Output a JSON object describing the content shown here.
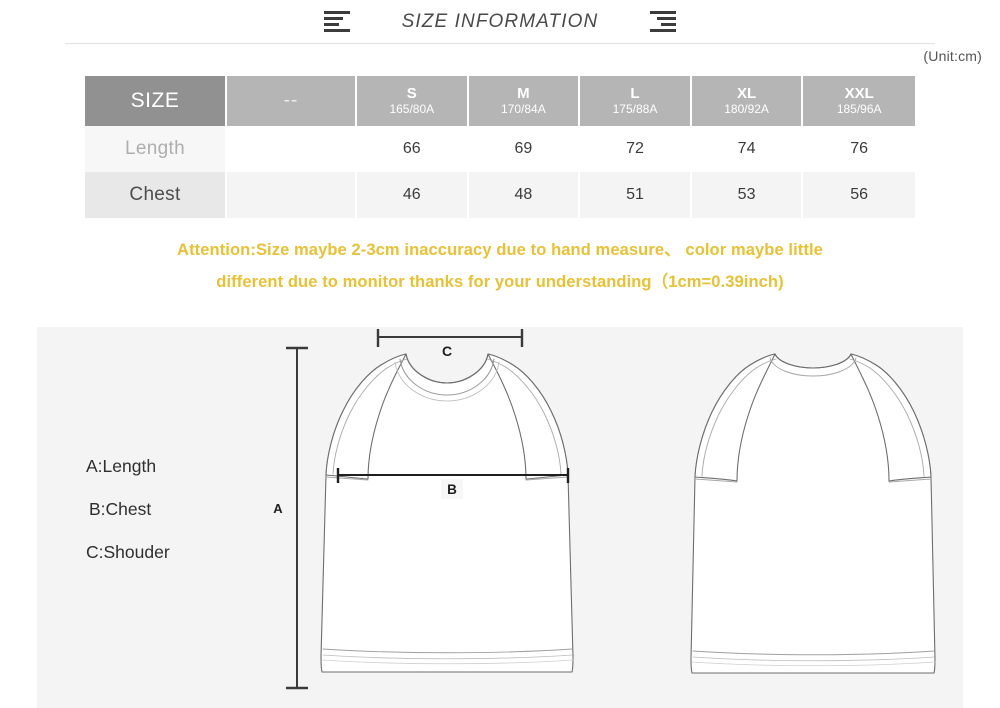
{
  "header": {
    "title": "SIZE INFORMATION",
    "left_icon": "align-left-icon",
    "right_icon": "align-right-icon"
  },
  "unit_note": "(Unit:cm)",
  "table": {
    "corner_label": "SIZE",
    "dash_label": "--",
    "columns": [
      {
        "name": "S",
        "spec": "165/80A"
      },
      {
        "name": "M",
        "spec": "170/84A"
      },
      {
        "name": "L",
        "spec": "175/88A"
      },
      {
        "name": "XL",
        "spec": "180/92A"
      },
      {
        "name": "XXL",
        "spec": "185/96A"
      }
    ],
    "rows": [
      {
        "label": "Length",
        "values": [
          "66",
          "69",
          "72",
          "74",
          "76"
        ]
      },
      {
        "label": "Chest",
        "values": [
          "46",
          "48",
          "51",
          "53",
          "56"
        ]
      }
    ]
  },
  "attention": {
    "line1": "Attention:Size maybe 2-3cm inaccuracy due to hand measure、  color maybe little",
    "line2": "different due to monitor thanks for your understanding（1cm=0.39inch)",
    "color": "#e8c135"
  },
  "diagram": {
    "legend": [
      "A:Length",
      "B:Chest",
      "C:Shouder"
    ],
    "measure_labels": {
      "a": "A",
      "b": "B",
      "c": "C"
    },
    "panel_color": "#f4f4f4",
    "garments": [
      {
        "view": "front"
      },
      {
        "view": "back"
      }
    ]
  },
  "colors": {
    "header_dark": "#919191",
    "header_light": "#b5b5b5",
    "row_alt": "#f4f4f4",
    "accent_yellow": "#e8c135"
  }
}
